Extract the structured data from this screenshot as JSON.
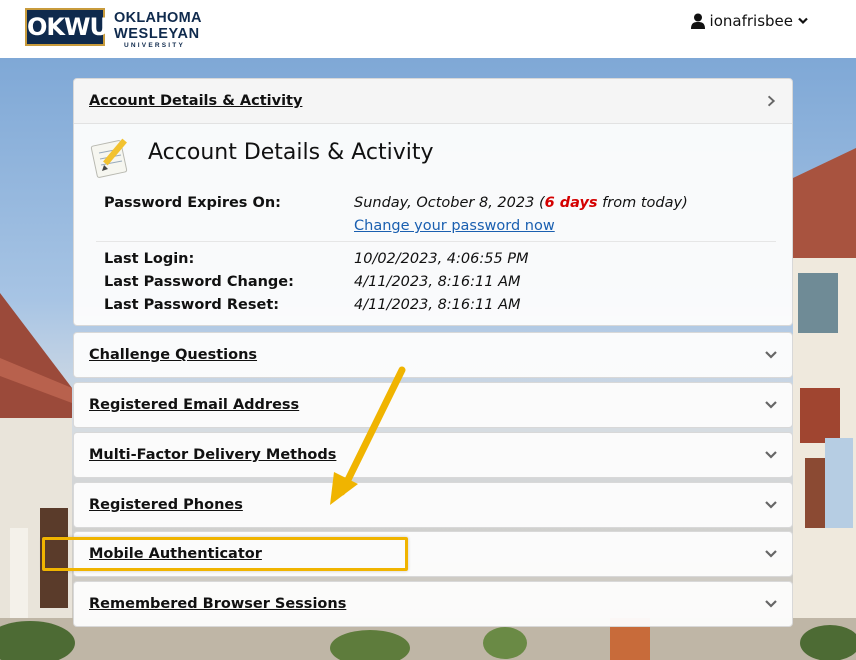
{
  "header": {
    "logo_mark": "OKWU",
    "logo_line1": "OKLAHOMA",
    "logo_line2": "WESLEYAN",
    "logo_line3": "UNIVERSITY",
    "username": "ionafrisbee"
  },
  "account": {
    "panel_title": "Account Details & Activity",
    "section_heading": "Account Details & Activity",
    "password_expires_label": "Password Expires On:",
    "password_expires_date": "Sunday, October 8, 2023 (",
    "password_expires_days": "6 days",
    "password_expires_suffix": " from today)",
    "change_password_link": "Change your password now",
    "last_login_label": "Last Login:",
    "last_login_value": "10/02/2023, 4:06:55 PM",
    "last_password_change_label": "Last Password Change:",
    "last_password_change_value": "4/11/2023, 8:16:11 AM",
    "last_password_reset_label": "Last Password Reset:",
    "last_password_reset_value": "4/11/2023, 8:16:11 AM"
  },
  "panels": [
    {
      "title": "Challenge Questions"
    },
    {
      "title": "Registered Email Address"
    },
    {
      "title": "Multi-Factor Delivery Methods"
    },
    {
      "title": "Registered Phones"
    },
    {
      "title": "Mobile Authenticator"
    },
    {
      "title": "Remembered Browser Sessions"
    }
  ],
  "colors": {
    "brand_navy": "#0f2a4d",
    "brand_gold": "#c89b3c",
    "highlight": "#f0b400",
    "days_red": "#d40000",
    "link_blue": "#1a5fb0"
  }
}
